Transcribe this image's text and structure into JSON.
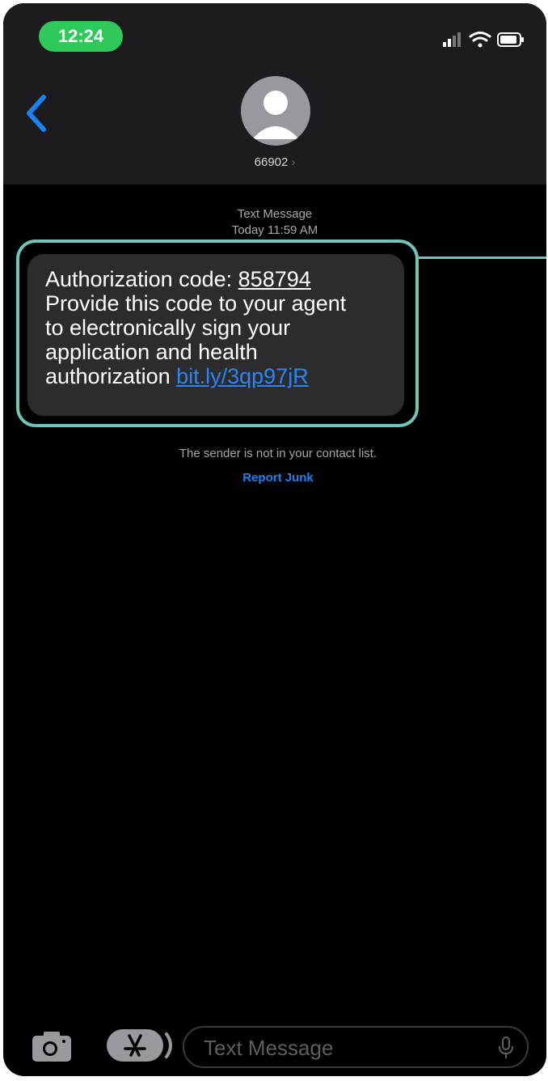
{
  "status_bar": {
    "time": "12:24"
  },
  "header": {
    "contact": "66902",
    "contact_chevron": "›"
  },
  "thread": {
    "meta_label": "Text Message",
    "meta_time": "Today 11:59 AM",
    "message": {
      "prefix": "Authorization code: ",
      "code": "858794",
      "line2": "Provide this code to your agent",
      "line3": "to electronically sign your",
      "line4": "application and health",
      "line5_prefix": "authorization ",
      "link": "bit.ly/3qp97jR"
    },
    "notice": "The sender is not in your contact list.",
    "report_junk": "Report Junk"
  },
  "input_bar": {
    "placeholder": "Text Message"
  },
  "colors": {
    "accent": "#2a86f5",
    "highlight": "#6ec5b8",
    "time_pill": "#2fc95a"
  },
  "icons": [
    "back-chevron-icon",
    "person-icon",
    "signal-icon",
    "wifi-icon",
    "battery-icon",
    "camera-icon",
    "app-store-icon",
    "microphone-icon"
  ]
}
